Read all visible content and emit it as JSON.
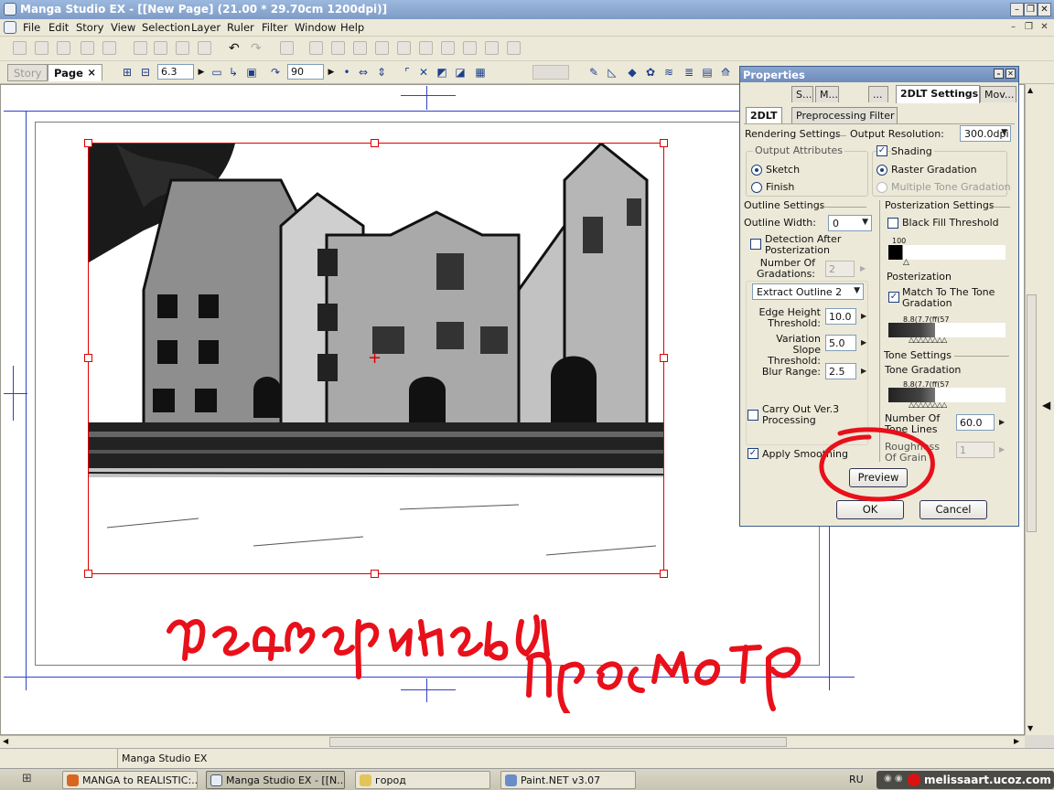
{
  "window": {
    "title": "Manga Studio EX - [[New Page] (21.00 * 29.70cm 1200dpi)]"
  },
  "menu": [
    "File",
    "Edit",
    "Story",
    "View",
    "Selection",
    "Layer",
    "Ruler",
    "Filter",
    "Window",
    "Help"
  ],
  "doc_tabs": {
    "story": "Story",
    "page": "Page",
    "close": "×"
  },
  "toolbar2": {
    "value1": "6.3",
    "value2": "90"
  },
  "properties": {
    "title": "Properties",
    "tabs": [
      "S...",
      "M...",
      "...",
      "2DLT Settings",
      "Mov..."
    ],
    "subtabs": [
      "2DLT",
      "Preprocessing Filter"
    ],
    "rendering_settings": "Rendering Settings",
    "output_resolution_label": "Output Resolution:",
    "output_resolution_value": "300.0dpi",
    "output_attributes": "Output Attributes",
    "sketch": "Sketch",
    "finish": "Finish",
    "shading": "Shading",
    "raster_gradation": "Raster Gradation",
    "multiple_tone_gradation": "Multiple Tone Gradation",
    "outline_settings": "Outline Settings",
    "outline_width_label": "Outline Width:",
    "outline_width_value": "0",
    "detection_after_posterization": "Detection After Posterization",
    "number_of_gradations_label": "Number Of Gradations:",
    "number_of_gradations_value": "2",
    "extract_outline": "Extract Outline 2",
    "edge_height_label": "Edge Height Threshold:",
    "edge_height_value": "10.0",
    "variation_slope_label": "Variation Slope Threshold:",
    "variation_slope_value": "5.0",
    "blur_range_label": "Blur Range:",
    "blur_range_value": "2.5",
    "carry_out_ver3": "Carry Out Ver.3 Processing",
    "apply_smoothing": "Apply Smoothing",
    "posterization_settings": "Posterization Settings",
    "black_fill_threshold": "Black Fill Threshold",
    "black_fill_value": "100",
    "posterization": "Posterization",
    "match_to_tone_gradation": "Match To The Tone Gradation",
    "posterization_scale": "8.8(7.7(ff(57",
    "tone_settings": "Tone Settings",
    "tone_gradation": "Tone Gradation",
    "tone_scale": "8.8(7.7(ff(57",
    "number_of_tone_lines_label": "Number Of Tone Lines",
    "number_of_tone_lines_value": "60.0",
    "roughness_of_grain_label": "Roughness Of Grain",
    "roughness_of_grain_value": "1",
    "preview_button": "Preview",
    "ok_button": "OK",
    "cancel_button": "Cancel"
  },
  "annotation": {
    "text": "предварительный просмотр",
    "color": "#e8101a"
  },
  "status": {
    "app_name": "Manga Studio EX"
  },
  "taskbar": {
    "start": "",
    "items": [
      "MANGA to REALISTIC:...",
      "Manga Studio EX - [[N...",
      "город",
      "Paint.NET v3.07"
    ],
    "lang": "RU",
    "site": "melissaart.ucoz.com"
  }
}
